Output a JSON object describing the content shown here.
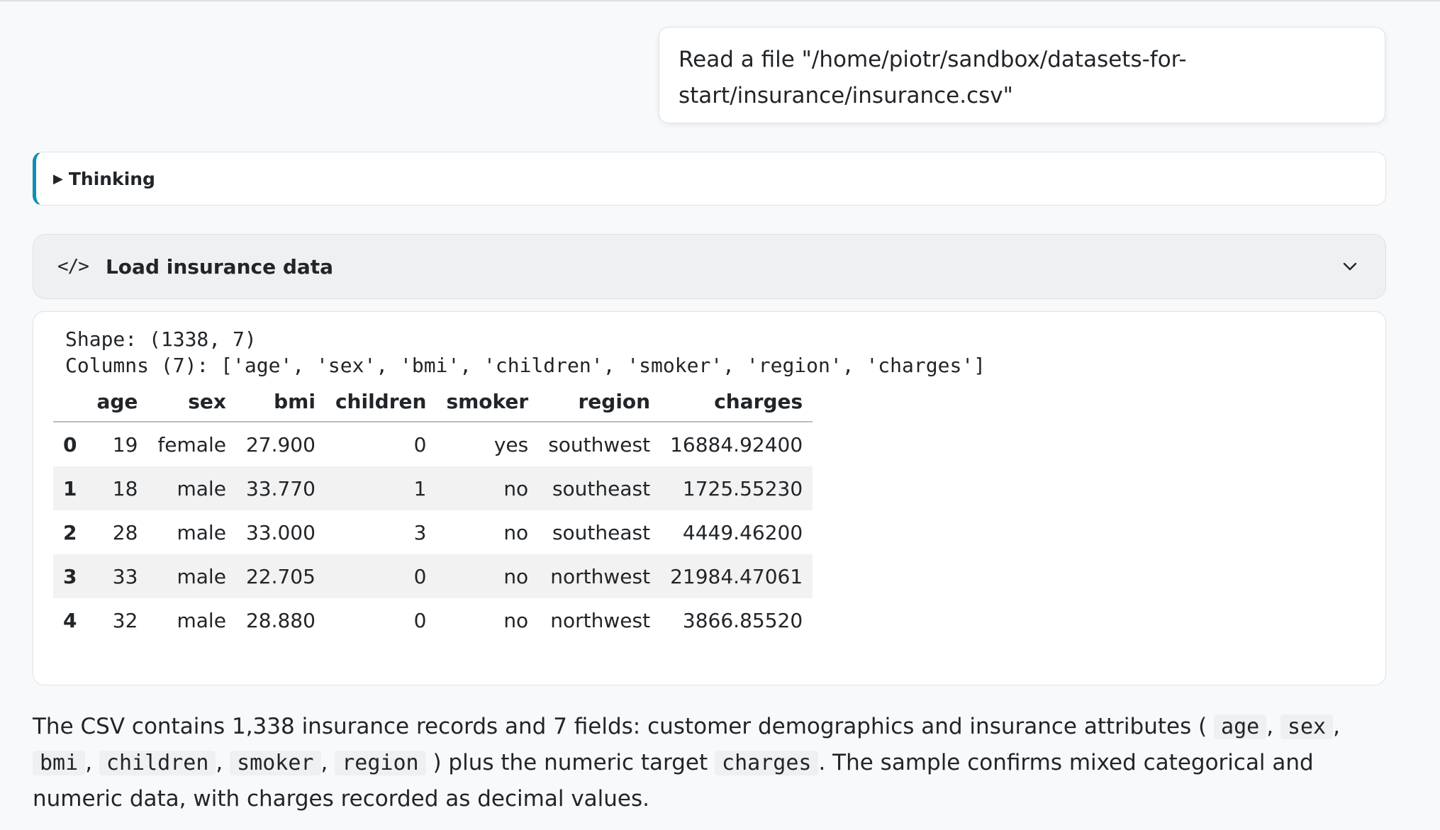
{
  "user_message": {
    "line1": "Read a file \"/home/piotr/sandbox/datasets-for-",
    "line2": "start/insurance/insurance.csv\""
  },
  "thinking": {
    "triangle": "▶",
    "label": "Thinking"
  },
  "code_cell": {
    "icon": "</>",
    "title": "Load insurance data"
  },
  "output": {
    "shape_line": "Shape: (1338, 7)",
    "columns_line": "Columns (7): ['age', 'sex', 'bmi', 'children', 'smoker', 'region', 'charges']",
    "table": {
      "headers": [
        "",
        "age",
        "sex",
        "bmi",
        "children",
        "smoker",
        "region",
        "charges"
      ],
      "rows": [
        [
          "0",
          "19",
          "female",
          "27.900",
          "0",
          "yes",
          "southwest",
          "16884.92400"
        ],
        [
          "1",
          "18",
          "male",
          "33.770",
          "1",
          "no",
          "southeast",
          "1725.55230"
        ],
        [
          "2",
          "28",
          "male",
          "33.000",
          "3",
          "no",
          "southeast",
          "4449.46200"
        ],
        [
          "3",
          "33",
          "male",
          "22.705",
          "0",
          "no",
          "northwest",
          "21984.47061"
        ],
        [
          "4",
          "32",
          "male",
          "28.880",
          "0",
          "no",
          "northwest",
          "3866.85520"
        ]
      ]
    }
  },
  "summary": {
    "t1": "The CSV contains 1,338 insurance records and 7 fields: customer demographics and insurance attributes (",
    "c1": "age",
    "s1": ",",
    "c2": "sex",
    "s2": ",",
    "c3": "bmi",
    "s3": ",",
    "c4": "children",
    "s4": ",",
    "c5": "smoker",
    "s5": ",",
    "c6": "region",
    "t2": ") plus the numeric target",
    "c7": "charges",
    "t3": ". The sample confirms mixed categorical and numeric data, with charges recorded as decimal values."
  }
}
